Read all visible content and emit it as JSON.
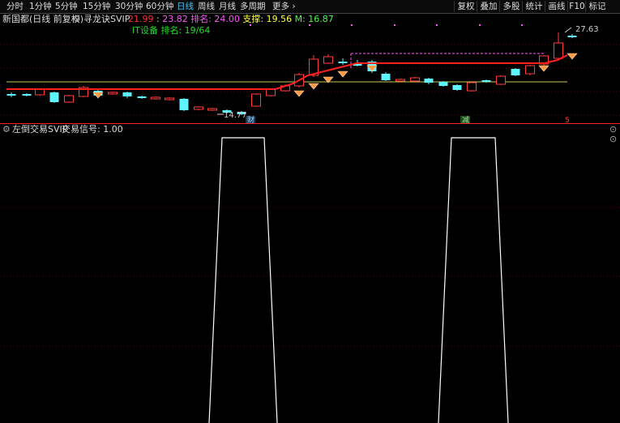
{
  "toolbar": {
    "periods": [
      "分时",
      "1分钟",
      "5分钟",
      "15分钟",
      "30分钟",
      "60分钟",
      "日线",
      "周线",
      "月线",
      "多周期",
      "更多"
    ],
    "active_period": "日线",
    "more_icon": "chevron-right-icon",
    "right_buttons": [
      "复权",
      "叠加",
      "多股",
      "统计",
      "画线",
      "F10",
      "标记"
    ]
  },
  "main_panel": {
    "stock_title": "新国都(日线 前复权)",
    "indicator_name": "寻龙诀SVIP",
    "values": [
      {
        "text": "21.99",
        "color": "#ff3333"
      },
      {
        "text": "23.82",
        "color": "#ff55ff"
      },
      {
        "text": "排名: 24.00",
        "color": "#ff55ff"
      },
      {
        "text": "支撑: 19.56",
        "color": "#ffff44"
      },
      {
        "text": "M: 16.87",
        "color": "#44ff44"
      }
    ],
    "sector_label": "IT设备 排名: 19/64",
    "high_label": "27.63",
    "low_label": "14.77",
    "markers": [
      {
        "text": "财",
        "color": "#9fd7ff",
        "bg": "#1a3a55"
      },
      {
        "text": "减",
        "color": "#9fe29f",
        "bg": "#1e4a1e"
      },
      {
        "text": "5",
        "color": "#ff4040",
        "bg": ""
      }
    ],
    "colors": {
      "up": "#ff3b3b",
      "down": "#5ff5ff",
      "trend_line": "#ff2020",
      "support_line": "#c8c85a",
      "dashed": "#ff55ff",
      "dots": "#ff55ff",
      "diamond": "#ff9a44"
    }
  },
  "sub_panel": {
    "indicator_name": "左倒交易SVIP",
    "signal_label": "交易信号: 1.00",
    "signal_color": "#ffffff"
  }
}
